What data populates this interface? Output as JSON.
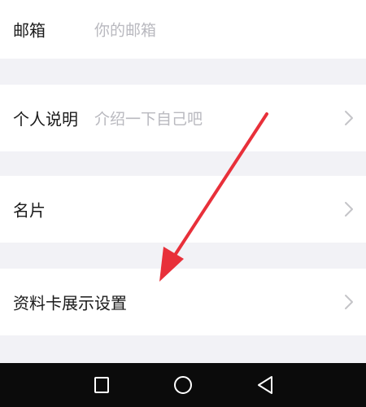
{
  "profile_form": {
    "email": {
      "label": "邮箱",
      "placeholder": "你的邮箱"
    },
    "bio": {
      "label": "个人说明",
      "placeholder": "介绍一下自己吧"
    },
    "business_card": {
      "label": "名片"
    },
    "card_display_settings": {
      "label": "资料卡展示设置"
    }
  },
  "icons": {
    "row_chevron": "chevron-right-icon",
    "nav_recents": "square-icon",
    "nav_home": "circle-icon",
    "nav_back": "triangle-back-icon",
    "annotation": "red-arrow-icon"
  },
  "colors": {
    "page_background": "#f2f2f6",
    "row_background": "#ffffff",
    "label_text": "#1a1a1a",
    "placeholder_text": "#b9b9bf",
    "annotation_arrow": "#e8303a",
    "navbar_background": "#0b0b0b"
  }
}
